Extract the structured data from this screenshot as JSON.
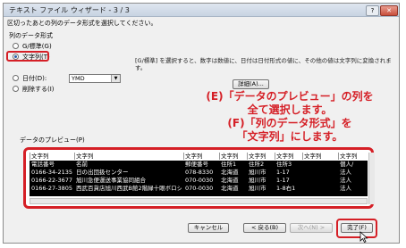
{
  "window": {
    "title": "テキスト ファイル ウィザード - 3 / 3",
    "help_button": "?",
    "close_button": "✕",
    "instruction": "区切ったあとの列のデータ形式を選択してください。"
  },
  "format_group": {
    "label": "列のデータ形式",
    "options": [
      {
        "label": "G/標準(G)",
        "selected": false
      },
      {
        "label": "文字列(T)",
        "selected": true
      },
      {
        "label": "日付(D):",
        "selected": false
      },
      {
        "label": "削除する(I)",
        "selected": false
      }
    ],
    "date_format_value": "YMD"
  },
  "description": "[G/標準] を選択すると、数字は数値に、日付は日付形式の値に、その他の値は文字列に変換されます。",
  "details_button": "詳細(A)...",
  "annotation": {
    "line1": "(E)「データのプレビュー」の列を",
    "line2": "全て選択します。",
    "line3": "(F)「列のデータ形式」を",
    "line4": "「文字列」にします。"
  },
  "preview": {
    "label": "データのプレビュー(P)",
    "headers": [
      "文字列",
      "文字列",
      "文字列",
      "文字列",
      "文字列",
      "文字列",
      "文字列",
      "文字列"
    ],
    "rows": [
      [
        "電話番号",
        "名前",
        "郵便番号",
        "住所1",
        "住所2",
        "住所3",
        "個人/"
      ],
      [
        "0166-34-2135",
        "日の出団扱センター",
        "078-8330",
        "北海道",
        "旭川市",
        "1-17",
        "法人"
      ],
      [
        "0166-22-3677",
        "旭川急便運送事業協同組合",
        "070-0030",
        "北海道",
        "旭川市",
        "1-17",
        "法人"
      ],
      [
        "0166-27-3805",
        "西武百貨店旭川西武B館2階緑十眼ボロショップ",
        "070-0030",
        "北海道",
        "旭川市",
        "1-8右1",
        "法人"
      ]
    ]
  },
  "footer": {
    "cancel": "キャンセル",
    "back": "< 戻る(B)",
    "next": "次へ(N) >",
    "finish": "完了(F)"
  }
}
